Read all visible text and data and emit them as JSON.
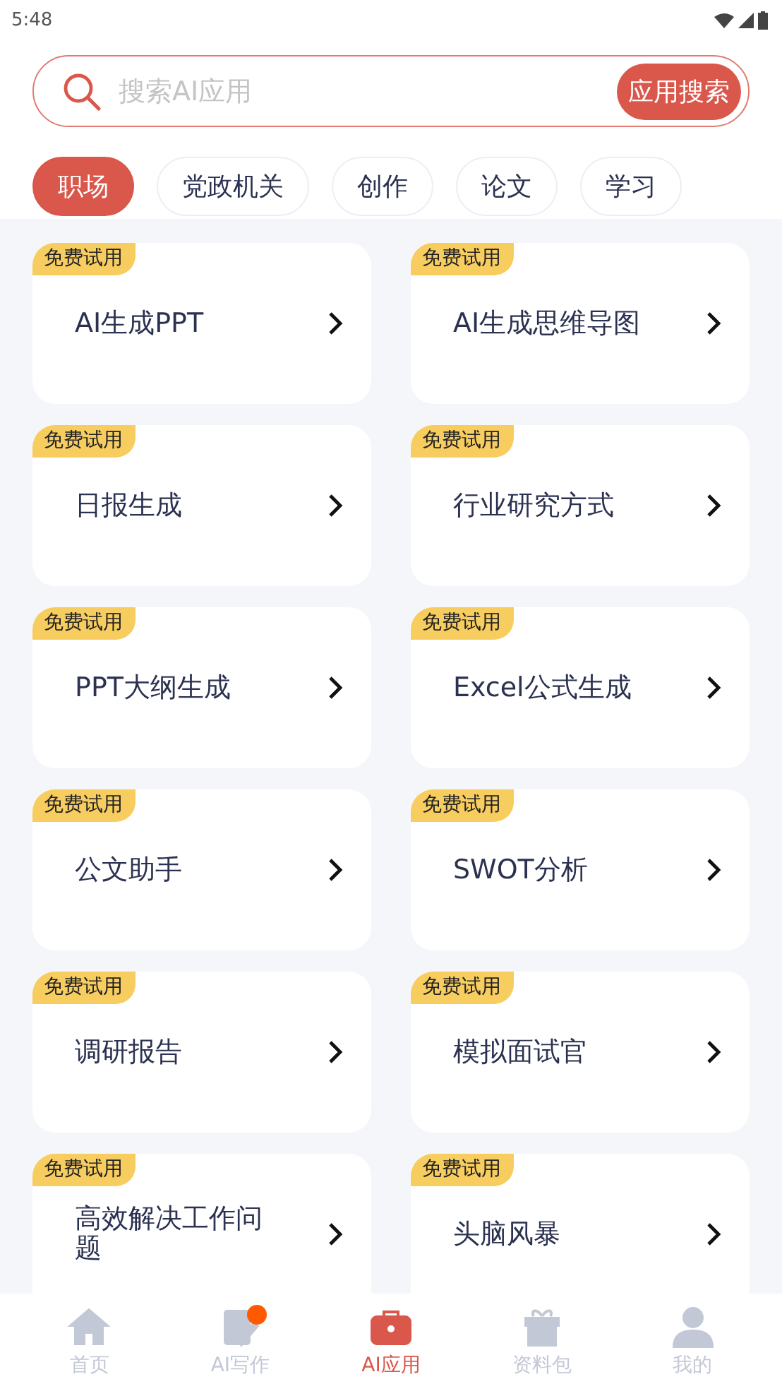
{
  "status_bar": {
    "time": "5:48"
  },
  "search": {
    "placeholder": "搜索AI应用",
    "button": "应用搜索"
  },
  "categories": [
    {
      "label": "职场",
      "selected": true
    },
    {
      "label": "党政机关",
      "selected": false
    },
    {
      "label": "创作",
      "selected": false
    },
    {
      "label": "论文",
      "selected": false
    },
    {
      "label": "学习",
      "selected": false
    }
  ],
  "apps": [
    {
      "badge": "免费试用",
      "title": "AI生成PPT"
    },
    {
      "badge": "免费试用",
      "title": "AI生成思维导图"
    },
    {
      "badge": "免费试用",
      "title": "日报生成"
    },
    {
      "badge": "免费试用",
      "title": "行业研究方式"
    },
    {
      "badge": "免费试用",
      "title": "PPT大纲生成"
    },
    {
      "badge": "免费试用",
      "title": "Excel公式生成"
    },
    {
      "badge": "免费试用",
      "title": "公文助手"
    },
    {
      "badge": "免费试用",
      "title": "SWOT分析"
    },
    {
      "badge": "免费试用",
      "title": "调研报告"
    },
    {
      "badge": "免费试用",
      "title": "模拟面试官"
    },
    {
      "badge": "免费试用",
      "title": "高效解决工作问题"
    },
    {
      "badge": "免费试用",
      "title": "头脑风暴"
    }
  ],
  "nav": [
    {
      "label": "首页",
      "kind": "home",
      "selected": false,
      "dot": false
    },
    {
      "label": "AI写作",
      "kind": "write",
      "selected": false,
      "dot": true
    },
    {
      "label": "AI应用",
      "kind": "toolbox",
      "selected": true,
      "dot": false
    },
    {
      "label": "资料包",
      "kind": "gift",
      "selected": false,
      "dot": false
    },
    {
      "label": "我的",
      "kind": "user",
      "selected": false,
      "dot": false
    }
  ]
}
